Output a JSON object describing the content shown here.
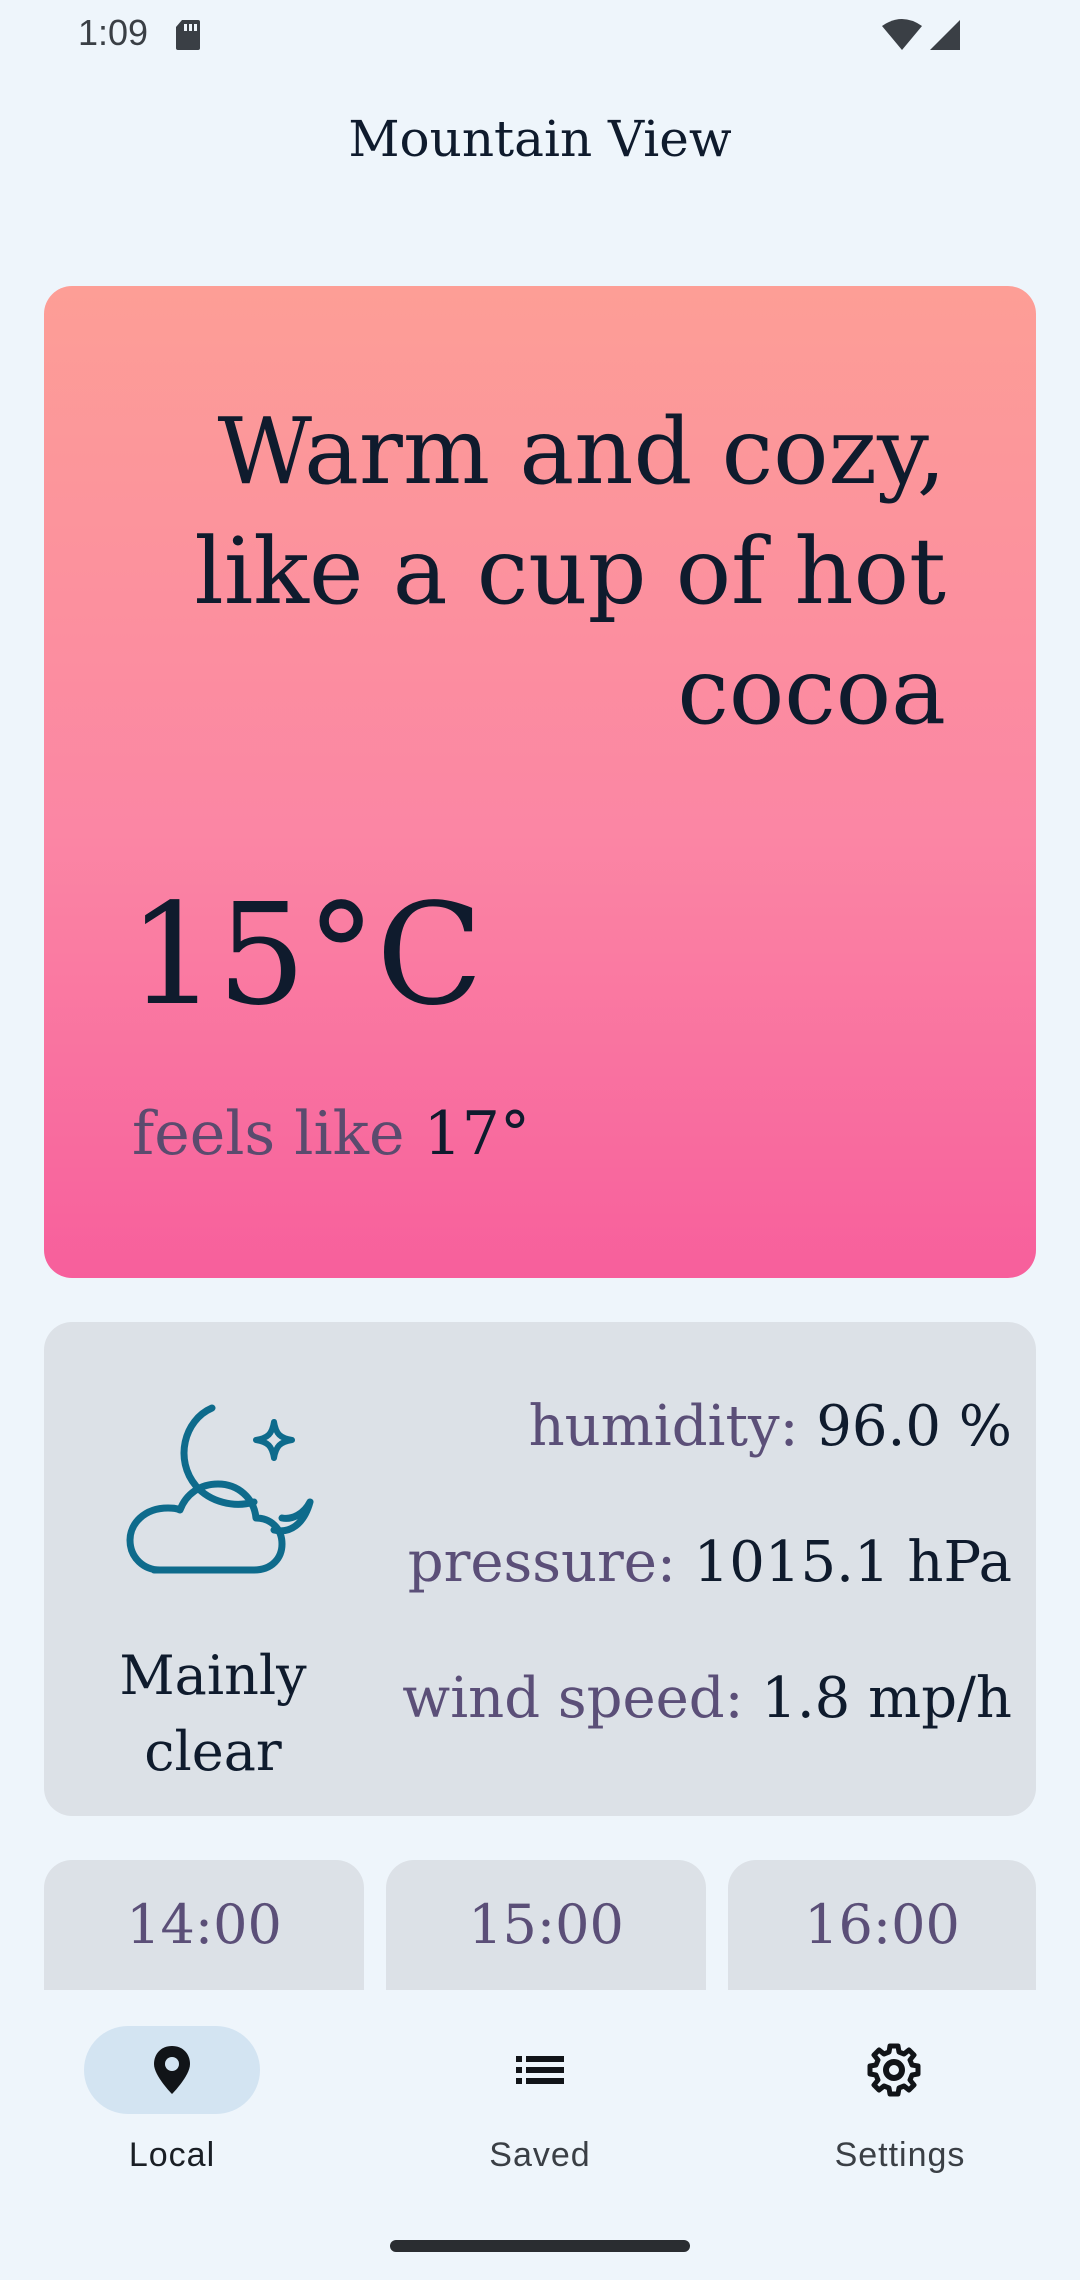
{
  "status_bar": {
    "time": "1:09",
    "icons": [
      "sd-card-icon",
      "wifi-icon",
      "cell-signal-icon"
    ]
  },
  "header": {
    "title": "Mountain View"
  },
  "hero": {
    "quote": "Warm and cozy, like a cup of hot cocoa",
    "temperature": "15°C",
    "feels_like_label": "feels like",
    "feels_like_value": "17°",
    "gradient_colors": [
      "#fd9e96",
      "#fb86a4",
      "#f75f9c"
    ]
  },
  "details": {
    "icon": "partly-cloudy-night-icon",
    "condition": "Mainly clear",
    "humidity_label": "humidity:",
    "humidity_value": "96.0 %",
    "pressure_label": "pressure:",
    "pressure_value": "1015.1 hPa",
    "wind_label": "wind speed:",
    "wind_value": "1.8 mp/h"
  },
  "hourly": [
    {
      "time": "14:00"
    },
    {
      "time": "15:00"
    },
    {
      "time": "16:00"
    }
  ],
  "nav": {
    "items": [
      {
        "label": "Local",
        "icon": "location-pin-icon",
        "selected": true
      },
      {
        "label": "Saved",
        "icon": "list-icon",
        "selected": false
      },
      {
        "label": "Settings",
        "icon": "gear-icon",
        "selected": false
      }
    ]
  },
  "colors": {
    "background": "#eef5fb",
    "card": "#dce1e7",
    "accent_icon": "#0e6b8c",
    "nav_selected_pill": "#d3e4f2"
  }
}
